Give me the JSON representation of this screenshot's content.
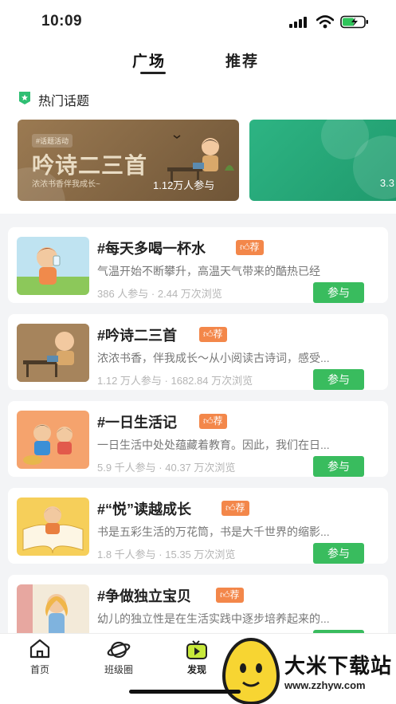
{
  "status_bar": {
    "time": "10:09"
  },
  "tabs": [
    {
      "label": "广场",
      "active": true
    },
    {
      "label": "推荐",
      "active": false
    }
  ],
  "hot_topics": {
    "title": "热门话题",
    "banners": [
      {
        "tag": "#话题活动",
        "title": "吟诗二三首",
        "subtitle": "浓浓书香伴我成长~",
        "count": "1.12万人参与",
        "color": "#8a6b47"
      },
      {
        "count": "3.3",
        "color": "#27a876"
      }
    ]
  },
  "topics": [
    {
      "title": "#每天多喝一杯水",
      "badge": "荐",
      "desc": "气温开始不断攀升，高温天气带来的酷热已经",
      "participants": "386 人参与",
      "views": "2.44 万次浏览",
      "button": "参与"
    },
    {
      "title": "#吟诗二三首",
      "badge": "荐",
      "desc": "浓浓书香，伴我成长～从小阅读古诗词，感受...",
      "participants": "1.12 万人参与",
      "views": "1682.84 万次浏览",
      "button": "参与"
    },
    {
      "title": "#一日生活记",
      "badge": "荐",
      "desc": "一日生活中处处蕴藏着教育。因此，我们在日...",
      "participants": "5.9 千人参与",
      "views": "40.37 万次浏览",
      "button": "参与"
    },
    {
      "title": "#“悦”读越成长",
      "badge": "荐",
      "desc": "书是五彩生活的万花筒，书是大千世界的缩影...",
      "participants": "1.8 千人参与",
      "views": "15.35 万次浏览",
      "button": "参与"
    },
    {
      "title": "#争做独立宝贝",
      "badge": "荐",
      "desc": "幼儿的独立性是在生活实践中逐步培养起来的...",
      "participants": "",
      "views": "",
      "button": "参与"
    }
  ],
  "bottom_nav": [
    {
      "label": "首页",
      "icon": "home-icon",
      "active": false
    },
    {
      "label": "班级圈",
      "icon": "planet-icon",
      "active": false
    },
    {
      "label": "发现",
      "icon": "play-tv-icon",
      "active": true
    }
  ],
  "watermark": {
    "text": "大米下载站",
    "url": "www.zzhyw.com"
  },
  "colors": {
    "accent_green": "#39bc5e",
    "badge_orange": "#f3874a",
    "hot_icon_green": "#2fbf73"
  }
}
